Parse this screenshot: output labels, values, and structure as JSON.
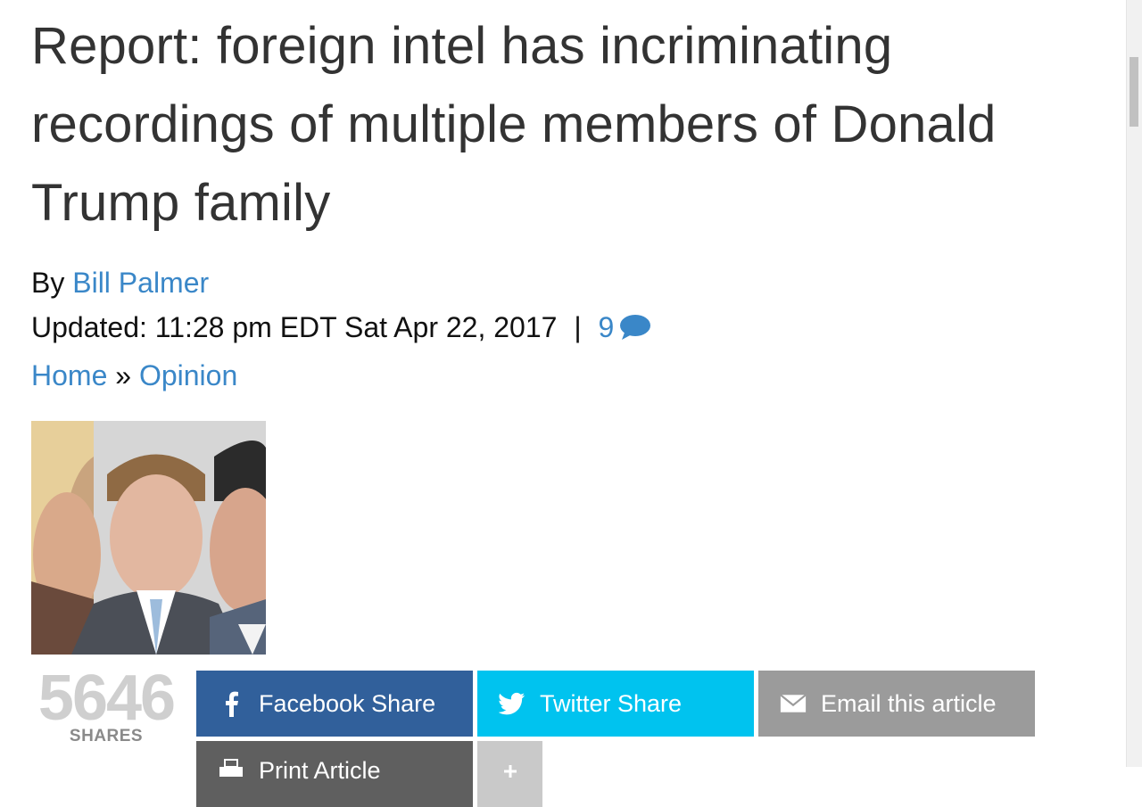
{
  "article": {
    "title": "Report: foreign intel has incriminating recordings of multiple members of Donald Trump family",
    "byline_prefix": "By",
    "author": "Bill Palmer",
    "updated_label": "Updated:",
    "updated_time": "11:28 pm EDT Sat Apr 22, 2017",
    "separator": "|",
    "comment_count": "9",
    "breadcrumb": {
      "home": "Home",
      "sep": "»",
      "section": "Opinion"
    }
  },
  "share": {
    "count": "5646",
    "count_label": "SHARES",
    "facebook": "Facebook Share",
    "twitter": "Twitter Share",
    "email": "Email this article",
    "print": "Print Article"
  },
  "icons": {
    "comment": "comment-bubble-icon",
    "facebook": "facebook-icon",
    "twitter": "twitter-icon",
    "email": "envelope-icon",
    "print": "printer-icon",
    "more": "plus-icon"
  },
  "colors": {
    "link": "#3a87c8",
    "facebook": "#31609b",
    "twitter": "#00c3ef",
    "email": "#9b9b9b",
    "print": "#5f5f5f"
  }
}
